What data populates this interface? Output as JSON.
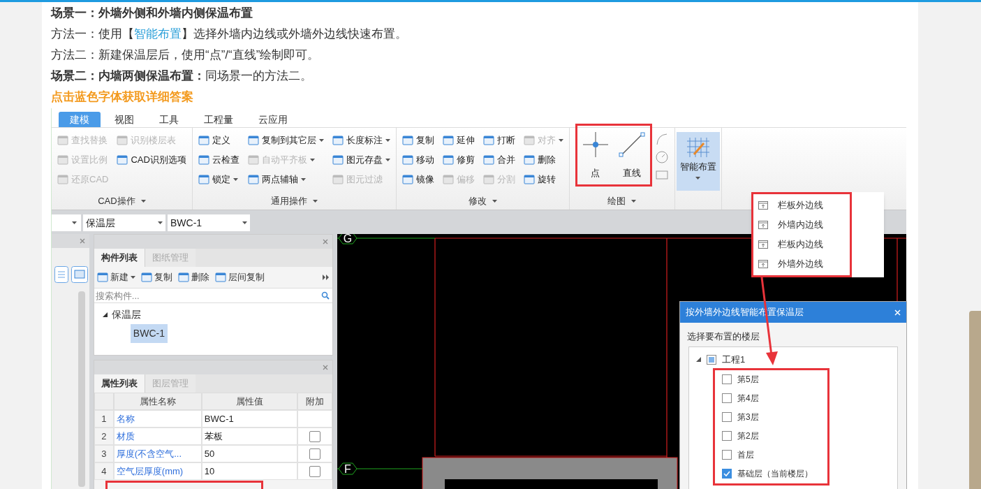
{
  "article": {
    "lines": [
      {
        "kind": "heading",
        "text": "场景一：外墙外侧和外墙内侧保温布置"
      },
      {
        "kind": "link_para",
        "before": "方法一：使用【",
        "link": "智能布置",
        "after": "】选择外墙内边线或外墙外边线快速布置。"
      },
      {
        "kind": "para",
        "text": "方法二：新建保温层后，使用“点”/“直线”绘制即可。"
      },
      {
        "kind": "para",
        "text": "**场景二：内墙两侧保温布置：**同场景一的方法二。"
      },
      {
        "kind": "notice",
        "text": "点击蓝色字体获取详细答案"
      }
    ]
  },
  "app": {
    "tabs": [
      {
        "label": "建模",
        "selected": true
      },
      {
        "label": "视图",
        "selected": false
      },
      {
        "label": "工具",
        "selected": false
      },
      {
        "label": "工程量",
        "selected": false
      },
      {
        "label": "云应用",
        "selected": false
      }
    ],
    "ribbon": {
      "groups": [
        {
          "kind": "small",
          "label": "CAD操作",
          "columns": [
            [
              {
                "label": "查找替换",
                "disabled": true,
                "dropdown": false
              },
              {
                "label": "设置比例",
                "disabled": true,
                "dropdown": false
              },
              {
                "label": "还原CAD",
                "disabled": true,
                "dropdown": false
              }
            ],
            [
              {
                "label": "识别楼层表",
                "disabled": true,
                "dropdown": false
              },
              {
                "label": "CAD识别选项",
                "disabled": false,
                "dropdown": false
              }
            ]
          ]
        },
        {
          "kind": "small",
          "label": "通用操作",
          "columns": [
            [
              {
                "label": "定义",
                "disabled": false,
                "dropdown": false
              },
              {
                "label": "云检查",
                "disabled": false,
                "dropdown": false
              },
              {
                "label": "锁定",
                "disabled": false,
                "dropdown": true
              }
            ],
            [
              {
                "label": "复制到其它层",
                "disabled": false,
                "dropdown": true
              },
              {
                "label": "自动平齐板",
                "disabled": true,
                "dropdown": true
              },
              {
                "label": "两点辅轴",
                "disabled": false,
                "dropdown": true
              }
            ],
            [
              {
                "label": "长度标注",
                "disabled": false,
                "dropdown": true
              },
              {
                "label": "图元存盘",
                "disabled": false,
                "dropdown": true
              },
              {
                "label": "图元过滤",
                "disabled": true,
                "dropdown": false
              }
            ]
          ]
        },
        {
          "kind": "small",
          "label": "修改",
          "columns": [
            [
              {
                "label": "复制",
                "disabled": false,
                "dropdown": false
              },
              {
                "label": "移动",
                "disabled": false,
                "dropdown": false
              },
              {
                "label": "镜像",
                "disabled": false,
                "dropdown": false
              }
            ],
            [
              {
                "label": "延伸",
                "disabled": false,
                "dropdown": false
              },
              {
                "label": "修剪",
                "disabled": false,
                "dropdown": false
              },
              {
                "label": "偏移",
                "disabled": true,
                "dropdown": false
              }
            ],
            [
              {
                "label": "打断",
                "disabled": false,
                "dropdown": false
              },
              {
                "label": "合并",
                "disabled": false,
                "dropdown": false
              },
              {
                "label": "分割",
                "disabled": true,
                "dropdown": false
              }
            ],
            [
              {
                "label": "对齐",
                "disabled": true,
                "dropdown": true
              },
              {
                "label": "删除",
                "disabled": false,
                "dropdown": false
              },
              {
                "label": "旋转",
                "disabled": false,
                "dropdown": false
              }
            ]
          ]
        },
        {
          "kind": "draw",
          "label": "绘图",
          "buttons": [
            {
              "kind": "point",
              "label": "点"
            },
            {
              "kind": "line",
              "label": "直线"
            }
          ]
        },
        {
          "kind": "big",
          "label": "智能布置",
          "selected": true
        }
      ]
    },
    "selectors": [
      "保温层",
      "BWC-1"
    ],
    "component_panel": {
      "tabs": [
        {
          "label": "构件列表",
          "selected": true
        },
        {
          "label": "图纸管理",
          "selected": false
        }
      ],
      "toolbar": [
        {
          "label": "新建",
          "dropdown": true
        },
        {
          "label": "复制",
          "dropdown": false
        },
        {
          "label": "删除",
          "dropdown": false
        },
        {
          "label": "层间复制",
          "dropdown": false
        }
      ],
      "search": {
        "placeholder": "搜索构件..."
      },
      "tree": [
        {
          "label": "保温层",
          "expanded": true,
          "children": [
            {
              "label": "BWC-1",
              "selected": true
            }
          ]
        }
      ]
    },
    "property_panel": {
      "tabs": [
        {
          "label": "属性列表",
          "selected": true
        },
        {
          "label": "图层管理",
          "selected": false
        }
      ],
      "columns": [
        "属性名称",
        "属性值",
        "附加"
      ],
      "rows": [
        {
          "num": "1",
          "name": "名称",
          "value": "BWC-1"
        },
        {
          "num": "2",
          "name": "材质",
          "value": "苯板",
          "checked": false
        },
        {
          "num": "3",
          "name": "厚度(不含空气...",
          "value": "50",
          "checked": false
        },
        {
          "num": "4",
          "name": "空气层厚度(mm)",
          "value": "10",
          "checked": false
        }
      ]
    },
    "canvas": {
      "axis_labels": [
        "G",
        "F"
      ]
    },
    "menu": {
      "items": [
        "栏板外边线",
        "外墙内边线",
        "栏板内边线",
        "外墙外边线"
      ]
    },
    "dialog": {
      "title": "按外墙外边线智能布置保温层",
      "prompt": "选择要布置的楼层",
      "tree": {
        "label": "工程1",
        "expanded": true,
        "checked": false,
        "partial": true,
        "children": [
          {
            "label": "第5层",
            "checked": false
          },
          {
            "label": "第4层",
            "checked": false
          },
          {
            "label": "第3层",
            "checked": false
          },
          {
            "label": "第2层",
            "checked": false
          },
          {
            "label": "首层",
            "checked": false
          },
          {
            "label": "基础层（当前楼层）",
            "checked": true
          }
        ]
      }
    }
  }
}
